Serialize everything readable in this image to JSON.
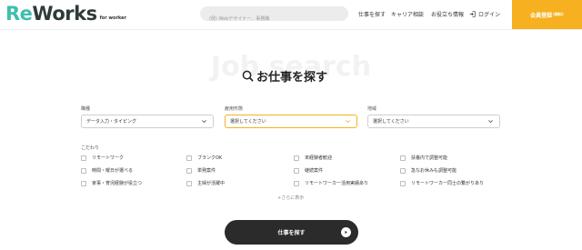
{
  "header": {
    "logo_main_part1": "Re",
    "logo_main_part2": "Works",
    "logo_sub": "for worker",
    "search_placeholder": "(例) Webデザイナー、事務職",
    "nav": {
      "search": "仕事を探す",
      "career": "キャリア相談",
      "useful": "お役立ち情報",
      "login": "ログイン"
    },
    "register_label": "会員登録",
    "register_badge": "(無料)",
    "brand_colors": {
      "teal": "#3fbfae",
      "orange": "#f6b020"
    }
  },
  "hero": {
    "bg_text": "Job search",
    "title": "お仕事を探す"
  },
  "filters": {
    "job_type": {
      "label": "職種",
      "value": "データ入力・タイピング"
    },
    "employment": {
      "label": "雇用形態",
      "value": "選択してください"
    },
    "area": {
      "label": "地域",
      "value": "選択してください"
    }
  },
  "conditions": {
    "label": "こだわり",
    "items": [
      "リモートワーク",
      "ブランクOK",
      "未経験者歓迎",
      "扶養内で調整可能",
      "時間・曜日が選べる",
      "単発案件",
      "継続案件",
      "急なお休みも調整可能",
      "家事・育児経験が役立つ",
      "主婦が活躍中",
      "リモートワーカー活用実績あり",
      "リモートワーカー同士の繋がりあり"
    ],
    "more": "+さらに表示"
  },
  "search_button": {
    "label": "仕事を探す"
  }
}
